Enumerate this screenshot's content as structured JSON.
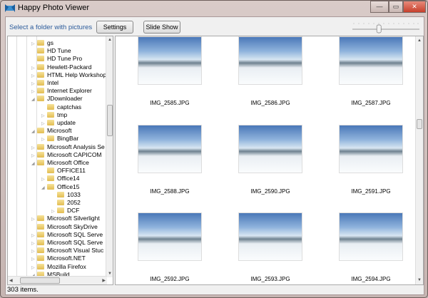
{
  "window": {
    "title": "Happy Photo Viewer",
    "minimize": "—",
    "maximize": "▭",
    "close": "✕"
  },
  "toolbar": {
    "label": "Select a folder with pictures",
    "settings": "Settings",
    "slideshow": "Slide Show",
    "zoom_slider_value": 0.4
  },
  "tree": [
    {
      "label": "gs",
      "level": 1,
      "exp": "▷"
    },
    {
      "label": "HD Tune",
      "level": 1,
      "exp": ""
    },
    {
      "label": "HD Tune Pro",
      "level": 1,
      "exp": ""
    },
    {
      "label": "Hewlett-Packard",
      "level": 1,
      "exp": "▷"
    },
    {
      "label": "HTML Help Workshop",
      "level": 1,
      "exp": "▷"
    },
    {
      "label": "Intel",
      "level": 1,
      "exp": "▷"
    },
    {
      "label": "Internet Explorer",
      "level": 1,
      "exp": "▷"
    },
    {
      "label": "JDownloader",
      "level": 1,
      "exp": "◢"
    },
    {
      "label": "captchas",
      "level": 2,
      "exp": ""
    },
    {
      "label": "tmp",
      "level": 2,
      "exp": "▷"
    },
    {
      "label": "update",
      "level": 2,
      "exp": "▷"
    },
    {
      "label": "Microsoft",
      "level": 1,
      "exp": "◢"
    },
    {
      "label": "BingBar",
      "level": 2,
      "exp": "▷"
    },
    {
      "label": "Microsoft Analysis Se",
      "level": 1,
      "exp": "▷"
    },
    {
      "label": "Microsoft CAPICOM",
      "level": 1,
      "exp": "▷"
    },
    {
      "label": "Microsoft Office",
      "level": 1,
      "exp": "◢"
    },
    {
      "label": "OFFICE11",
      "level": 2,
      "exp": ""
    },
    {
      "label": "Office14",
      "level": 2,
      "exp": "▷"
    },
    {
      "label": "Office15",
      "level": 2,
      "exp": "◢"
    },
    {
      "label": "1033",
      "level": 3,
      "exp": ""
    },
    {
      "label": "2052",
      "level": 3,
      "exp": ""
    },
    {
      "label": "DCF",
      "level": 3,
      "exp": "▷"
    },
    {
      "label": "Microsoft Silverlight",
      "level": 1,
      "exp": "▷"
    },
    {
      "label": "Microsoft SkyDrive",
      "level": 1,
      "exp": ""
    },
    {
      "label": "Microsoft SQL Serve",
      "level": 1,
      "exp": "▷"
    },
    {
      "label": "Microsoft SQL Serve",
      "level": 1,
      "exp": "▷"
    },
    {
      "label": "Microsoft Visual Stuc",
      "level": 1,
      "exp": "▷"
    },
    {
      "label": "Microsoft.NET",
      "level": 1,
      "exp": "▷"
    },
    {
      "label": "Mozilla Firefox",
      "level": 1,
      "exp": "▷"
    },
    {
      "label": "MSBuild",
      "level": 1,
      "exp": "◢"
    }
  ],
  "photos": [
    "IMG_2585.JPG",
    "IMG_2586.JPG",
    "IMG_2587.JPG",
    "IMG_2588.JPG",
    "IMG_2590.JPG",
    "IMG_2591.JPG",
    "IMG_2592.JPG",
    "IMG_2593.JPG",
    "IMG_2594.JPG"
  ],
  "status": "303 items."
}
